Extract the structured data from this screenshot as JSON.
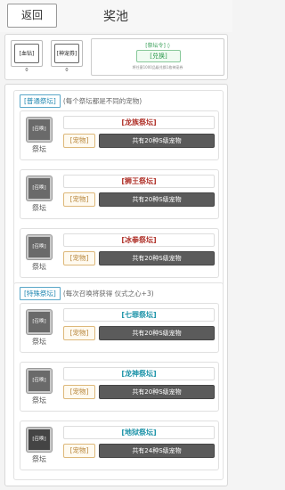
{
  "header": {
    "back_label": "返回",
    "title": "奖池"
  },
  "items": [
    {
      "label": "[血钻]",
      "count": "0"
    },
    {
      "label": "[神宠券]",
      "count": "0"
    }
  ],
  "exchange": {
    "title": "[祭坛令] ◊",
    "button_label": "[兑换]",
    "note": "将任意1000品级兑换1枚神宠券"
  },
  "groups": [
    {
      "tag": "[普通祭坛]",
      "desc": "(每个祭坛都是不同的宠物)",
      "altars": [
        {
          "summon_label": "[召唤]",
          "caption": "祭坛",
          "name": "[龙族祭坛]",
          "pet_tag": "[宠物]",
          "pet_count": "共有20种S级宠物",
          "name_color": "red",
          "dark": false
        },
        {
          "summon_label": "[召唤]",
          "caption": "祭坛",
          "name": "[狮王祭坛]",
          "pet_tag": "[宠物]",
          "pet_count": "共有20种S级宠物",
          "name_color": "red",
          "dark": false
        },
        {
          "summon_label": "[召唤]",
          "caption": "祭坛",
          "name": "[冰拳祭坛]",
          "pet_tag": "[宠物]",
          "pet_count": "共有20种S级宠物",
          "name_color": "red",
          "dark": false
        }
      ]
    },
    {
      "tag": "[特殊祭坛]",
      "desc": "(每次召唤将获得 仪式之心+3)",
      "altars": [
        {
          "summon_label": "[召唤]",
          "caption": "祭坛",
          "name": "[七罪祭坛]",
          "pet_tag": "[宠物]",
          "pet_count": "共有20种S级宠物",
          "name_color": "teal",
          "dark": false
        },
        {
          "summon_label": "[召唤]",
          "caption": "祭坛",
          "name": "[龙神祭坛]",
          "pet_tag": "[宠物]",
          "pet_count": "共有20种S级宠物",
          "name_color": "teal",
          "dark": false
        },
        {
          "summon_label": "[召唤]",
          "caption": "祭坛",
          "name": "[地狱祭坛]",
          "pet_tag": "[宠物]",
          "pet_count": "共有24种S级宠物",
          "name_color": "teal",
          "dark": true
        }
      ]
    }
  ]
}
